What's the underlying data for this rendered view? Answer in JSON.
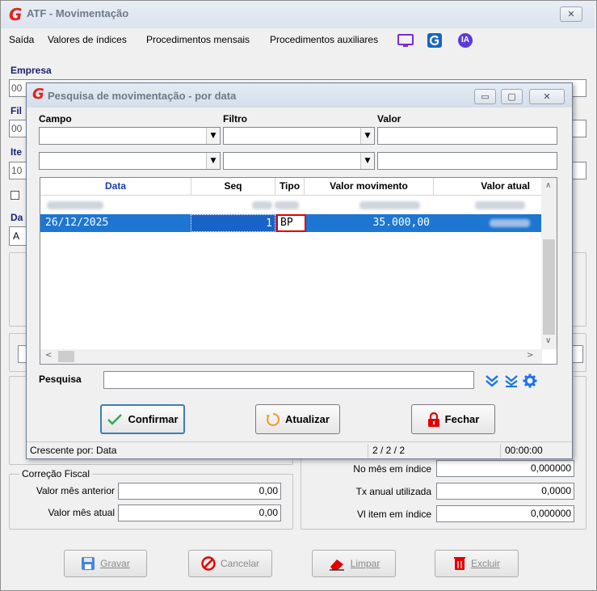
{
  "main": {
    "title": "ATF - Movimentação",
    "close_label": "✕",
    "menu": [
      {
        "label": "Saída"
      },
      {
        "label": "Valores de índices"
      },
      {
        "label": "Procedimentos mensais"
      },
      {
        "label": "Procedimentos auxiliares"
      }
    ],
    "menu_icons": [
      "monitor-icon",
      "g-logo-icon",
      "ia-icon"
    ],
    "ia_label": "IA",
    "labels": {
      "empresa": "Empresa",
      "filial": "Fil",
      "item": "Ite",
      "data": "Da"
    },
    "field_prefixes": {
      "empresa": "00",
      "filial": "00",
      "item": "10",
      "data": "A"
    },
    "correcao_fiscal": {
      "title": "Correção Fiscal",
      "rows": [
        {
          "label": "Valor mês anterior",
          "value": "0,00"
        },
        {
          "label": "Valor mês atual",
          "value": "0,00"
        }
      ]
    },
    "right_rows": [
      {
        "label": "No mês em índice",
        "value": "0,000000"
      },
      {
        "label": "Tx anual utilizada",
        "value": "0,0000"
      },
      {
        "label": "Vl item em índice",
        "value": "0,000000"
      }
    ],
    "bottom_buttons": [
      {
        "label": "Gravar",
        "icon": "floppy-icon"
      },
      {
        "label": "Cancelar",
        "icon": "cancel-icon"
      },
      {
        "label": "Limpar",
        "icon": "eraser-icon"
      },
      {
        "label": "Excluir",
        "icon": "trash-icon"
      }
    ]
  },
  "dialog": {
    "title": "Pesquisa de movimentação - por data",
    "window_buttons": {
      "minimize": "▭",
      "maximize": "▢",
      "close": "✕"
    },
    "filter_headers": {
      "campo": "Campo",
      "filtro": "Filtro",
      "valor": "Valor"
    },
    "grid": {
      "columns": [
        "Data",
        "Seq",
        "Tipo",
        "Valor movimento",
        "Valor atual"
      ],
      "rows": [
        {
          "data": "",
          "seq": "",
          "tipo": "",
          "valor_movimento": "",
          "valor_atual": "",
          "blurred": true
        },
        {
          "data": "26/12/2025",
          "seq": "1",
          "tipo": "BP",
          "valor_movimento": "35.000,00",
          "valor_atual": "",
          "selected": true
        }
      ]
    },
    "search_label": "Pesquisa",
    "search_value": "",
    "search_icons": [
      "double-chevron-down-icon",
      "filter-down-icon",
      "gear-icon"
    ],
    "buttons": {
      "confirm": "Confirmar",
      "refresh": "Atualizar",
      "close": "Fechar"
    },
    "status": {
      "sort": "Crescente por: Data",
      "count": "2 / 2 / 2",
      "time": "00:00:00"
    }
  },
  "colors": {
    "accent_blue": "#1a73e8",
    "selection_blue": "#1c76d2",
    "highlight_red": "#e00000",
    "brand_red": "#e2231a"
  }
}
